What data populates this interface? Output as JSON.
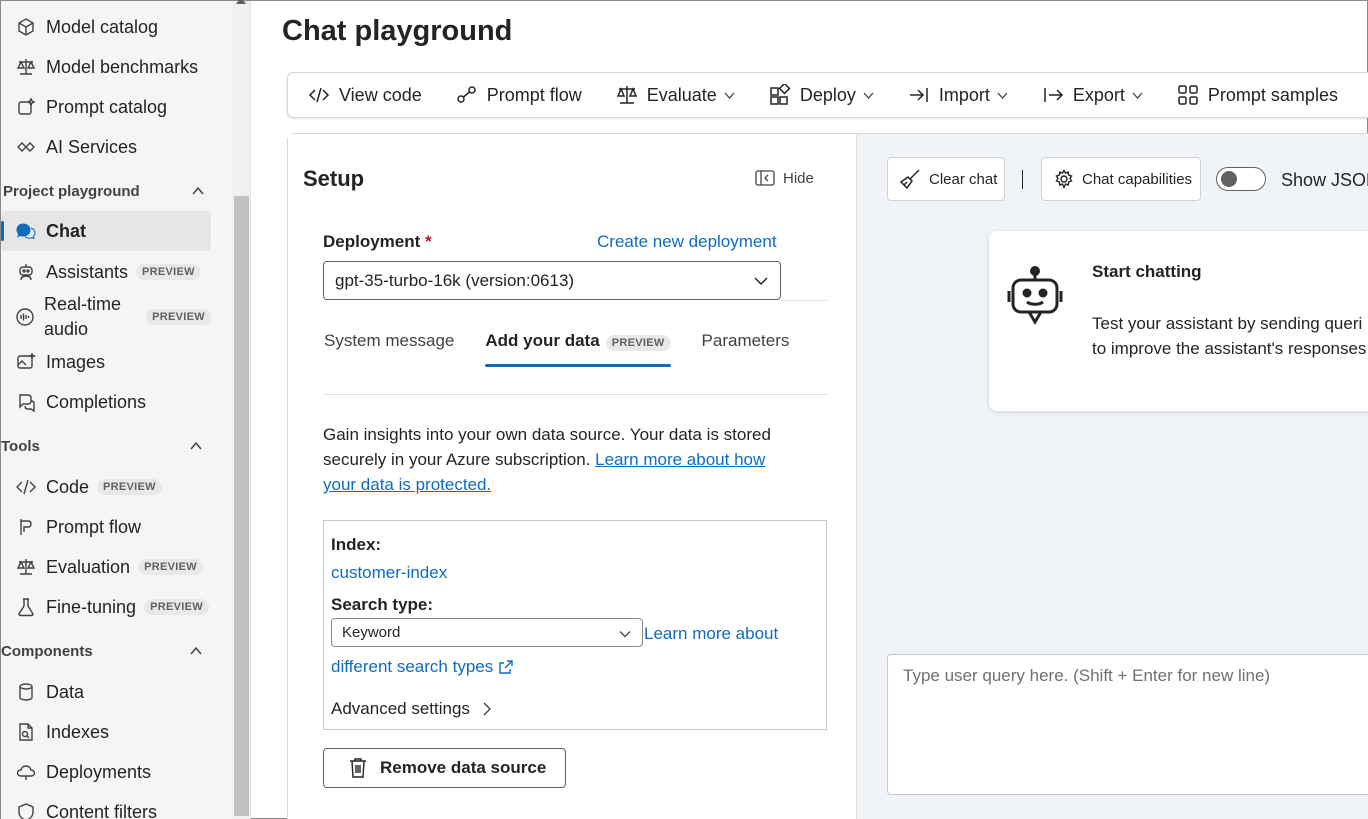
{
  "sidebar": {
    "items_top": [
      {
        "label": "Model catalog",
        "icon": "cube-icon"
      },
      {
        "label": "Model benchmarks",
        "icon": "scale-icon"
      },
      {
        "label": "Prompt catalog",
        "icon": "prompt-catalog-icon"
      },
      {
        "label": "AI Services",
        "icon": "ai-services-icon"
      }
    ],
    "project_playground": {
      "heading": "Project playground",
      "items": [
        {
          "label": "Chat",
          "icon": "chat-icon",
          "active": true
        },
        {
          "label": "Assistants",
          "icon": "assistant-icon",
          "badge": "PREVIEW"
        },
        {
          "label": "Real-time",
          "label2": "audio",
          "icon": "audio-icon",
          "badge": "PREVIEW"
        },
        {
          "label": "Images",
          "icon": "image-icon"
        },
        {
          "label": "Completions",
          "icon": "completions-icon"
        }
      ]
    },
    "tools": {
      "heading": "Tools",
      "items": [
        {
          "label": "Code",
          "icon": "code-icon",
          "badge": "PREVIEW"
        },
        {
          "label": "Prompt flow",
          "icon": "prompt-flow-icon"
        },
        {
          "label": "Evaluation",
          "icon": "scale-icon",
          "badge": "PREVIEW"
        },
        {
          "label": "Fine-tuning",
          "icon": "flask-icon",
          "badge": "PREVIEW"
        }
      ]
    },
    "components": {
      "heading": "Components",
      "items": [
        {
          "label": "Data",
          "icon": "database-icon"
        },
        {
          "label": "Indexes",
          "icon": "indexes-icon"
        },
        {
          "label": "Deployments",
          "icon": "cloud-icon"
        },
        {
          "label": "Content filters",
          "icon": "shield-icon"
        }
      ]
    }
  },
  "page": {
    "title": "Chat playground"
  },
  "toolbar": {
    "view_code": "View code",
    "prompt_flow": "Prompt flow",
    "evaluate": "Evaluate",
    "deploy": "Deploy",
    "import": "Import",
    "export": "Export",
    "prompt_samples": "Prompt samples"
  },
  "setup": {
    "title": "Setup",
    "hide": "Hide",
    "deployment_label": "Deployment",
    "required_mark": "*",
    "create_link": "Create new deployment",
    "deployment_value": "gpt-35-turbo-16k (version:0613)",
    "tabs": {
      "system_message": "System message",
      "add_your_data": "Add your data",
      "add_your_data_badge": "PREVIEW",
      "parameters": "Parameters"
    },
    "insight_text": "Gain insights into your own data source. Your data is stored securely in your Azure subscription.",
    "insight_link": "Learn more about how your data is protected.",
    "index_label": "Index:",
    "index_value": "customer-index",
    "search_type_label": "Search type:",
    "search_type_value": "Keyword",
    "learn_search_1": "Learn more about",
    "learn_search_2": "different search types",
    "advanced": "Advanced settings",
    "remove": "Remove data source"
  },
  "chat": {
    "clear": "Clear chat",
    "capabilities": "Chat capabilities",
    "show_json": "Show JSON",
    "show_json_on": false,
    "start_title": "Start chatting",
    "start_desc_1": "Test your assistant by sending queri",
    "start_desc_2": "to improve the assistant's responses",
    "query_placeholder": "Type user query here. (Shift + Enter for new line)"
  },
  "colors": {
    "accent": "#0f6cbd",
    "required": "#c50f1f",
    "chat_bg": "#f0f4f9"
  }
}
